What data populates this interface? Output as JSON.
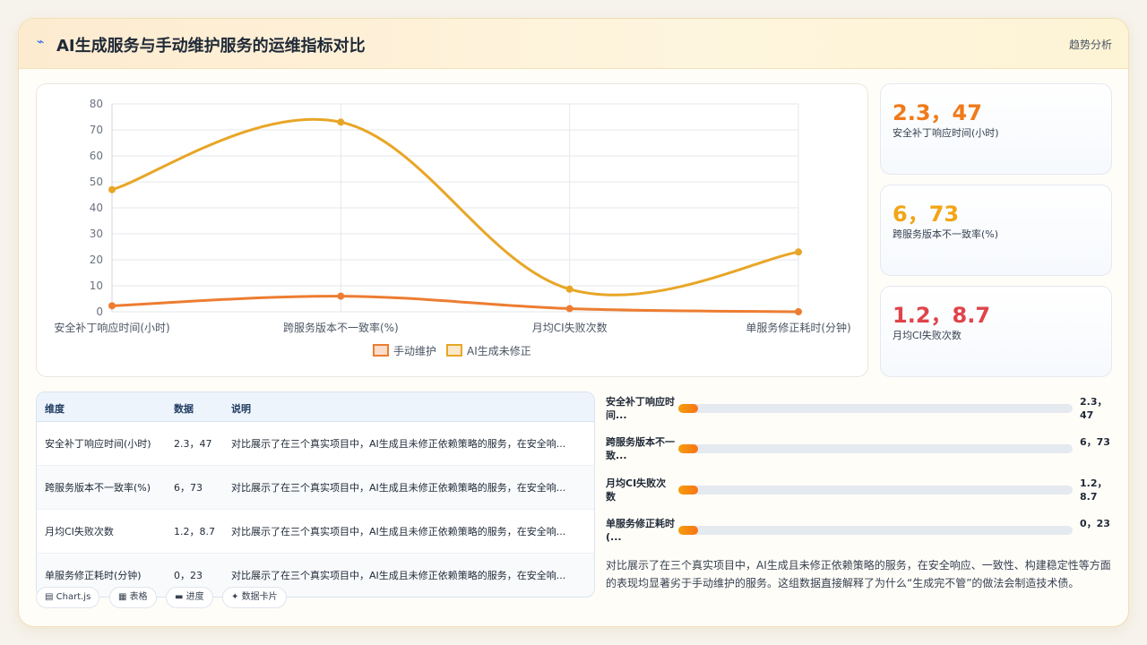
{
  "header": {
    "icon": "trend-icon",
    "icon_glyph": "⌁",
    "title": "AI生成服务与手动维护服务的运维指标对比",
    "link": "趋势分析"
  },
  "chart_data": {
    "type": "line",
    "categories": [
      "安全补丁响应时间(小时)",
      "跨服务版本不一致率(%)",
      "月均CI失败次数",
      "单服务修正耗时(分钟)"
    ],
    "series": [
      {
        "name": "手动维护",
        "values": [
          2.3,
          6,
          1.2,
          0
        ],
        "color": "#ed7d31"
      },
      {
        "name": "AI生成未修正",
        "values": [
          47,
          73,
          8.7,
          23
        ],
        "color": "#e8a627"
      }
    ],
    "ylim": [
      0,
      80
    ],
    "yticks": [
      "0",
      "10",
      "20",
      "30",
      "40",
      "50",
      "60",
      "70",
      "80"
    ],
    "grid": true,
    "smooth": true,
    "legend": "bottom"
  },
  "stats": [
    {
      "value": "2.3，47",
      "label": "安全补丁响应时间(小时)",
      "color": "#f07a1a"
    },
    {
      "value": "6，73",
      "label": "跨服务版本不一致率(%)",
      "color": "#f2a516"
    },
    {
      "value": "1.2，8.7",
      "label": "月均CI失败次数",
      "color": "#e0434a"
    }
  ],
  "table": {
    "headers": [
      "维度",
      "数据",
      "说明"
    ],
    "rows": [
      {
        "dim": "安全补丁响应时间(小时)",
        "data": "2.3，47",
        "desc": "对比展示了在三个真实项目中，AI生成且未修正依赖策略的服务，在安全响..."
      },
      {
        "dim": "跨服务版本不一致率(%)",
        "data": "6，73",
        "desc": "对比展示了在三个真实项目中，AI生成且未修正依赖策略的服务，在安全响..."
      },
      {
        "dim": "月均CI失败次数",
        "data": "1.2，8.7",
        "desc": "对比展示了在三个真实项目中，AI生成且未修正依赖策略的服务，在安全响..."
      },
      {
        "dim": "单服务修正耗时(分钟)",
        "data": "0，23",
        "desc": "对比展示了在三个真实项目中，AI生成且未修正依赖策略的服务，在安全响..."
      }
    ]
  },
  "chips": [
    {
      "icon": "chart-icon",
      "glyph": "▤",
      "label": "Chart.js"
    },
    {
      "icon": "table-icon",
      "glyph": "▦",
      "label": "表格"
    },
    {
      "icon": "progress-icon",
      "glyph": "▬",
      "label": "进度"
    },
    {
      "icon": "sparkle-icon",
      "glyph": "✦",
      "label": "数据卡片"
    }
  ],
  "bars": [
    {
      "label": "安全补丁响应时间...",
      "value": "2.3，47",
      "progress": 0.05
    },
    {
      "label": "跨服务版本不一致...",
      "value": "6，73",
      "progress": 0.05
    },
    {
      "label": "月均CI失败次数",
      "value": "1.2，8.7",
      "progress": 0.05
    },
    {
      "label": "单服务修正耗时(...",
      "value": "0，23",
      "progress": 0.05
    }
  ],
  "summary": "对比展示了在三个真实项目中，AI生成且未修正依赖策略的服务，在安全响应、一致性、构建稳定性等方面的表现均显著劣于手动维护的服务。这组数据直接解释了为什么“生成完不管”的做法会制造技术债。"
}
